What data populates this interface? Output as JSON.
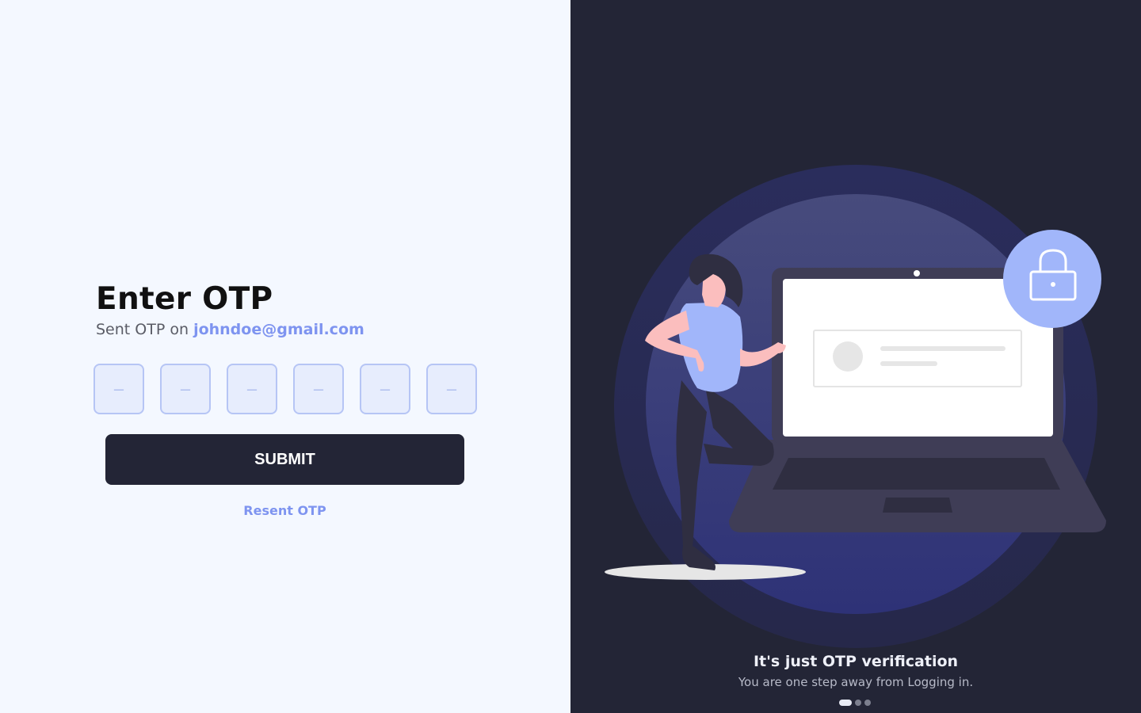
{
  "login": {
    "title": "Enter OTP",
    "subtitle_prefix": "Sent OTP on",
    "email": "johndoe@gmail.com",
    "otp_placeholder": "–",
    "otp_digits": [
      "",
      "",
      "",
      "",
      "",
      ""
    ],
    "submit_label": "SUBMIT",
    "resend_label": "Resent OTP"
  },
  "promo": {
    "title": "It's just OTP verification",
    "subtitle": "You are one step away from Logging in.",
    "slides": {
      "count": 3,
      "active": 1
    }
  },
  "colors": {
    "accent": "#7e94f0",
    "dark": "#232536",
    "background": "#f4f8ff"
  }
}
